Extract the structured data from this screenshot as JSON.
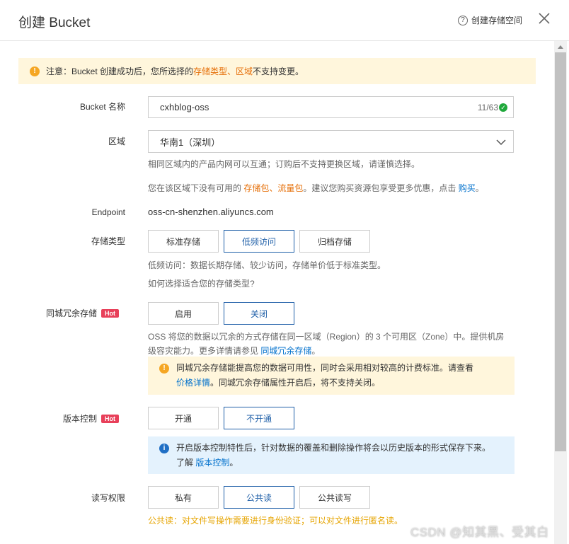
{
  "header": {
    "title": "创建 Bucket",
    "help_label": "创建存储空间",
    "help_icon": "help-circle-icon",
    "close_icon": "close-icon"
  },
  "notice": {
    "prefix": "注意：Bucket 创建成功后，您所选择的 ",
    "highlight": "存储类型、区域",
    "suffix": " 不支持变更。"
  },
  "bucket_name": {
    "label": "Bucket 名称",
    "value": "cxhblog-oss",
    "counter": "11/63"
  },
  "region": {
    "label": "区域",
    "value": "华南1（深圳）",
    "hint1": "相同区域内的产品内网可以互通；订购后不支持更换区域，请谨慎选择。",
    "hint2_prefix": "您在该区域下没有可用的 ",
    "hint2_highlight": "存储包、流量包",
    "hint2_mid": "。建议您购买资源包享受更多优惠，点击 ",
    "hint2_link": "购买",
    "hint2_suffix": "。"
  },
  "endpoint": {
    "label": "Endpoint",
    "value": "oss-cn-shenzhen.aliyuncs.com"
  },
  "storage_class": {
    "label": "存储类型",
    "options": [
      "标准存储",
      "低频访问",
      "归档存储"
    ],
    "selected": "低频访问",
    "hint": "低频访问：数据长期存储、较少访问，存储单价低于标准类型。",
    "link": "如何选择适合您的存储类型?"
  },
  "zone_redundancy": {
    "label": "同城冗余存储",
    "badge": "Hot",
    "options": [
      "启用",
      "关闭"
    ],
    "selected": "关闭",
    "hint_line1": "OSS 将您的数据以冗余的方式存储在同一区域（Region）的 3 个可用区（Zone）中。提供机房",
    "hint_line2_prefix": "级容灾能力。更多详情请参见 ",
    "hint_line2_link": "同城冗余存储",
    "hint_line2_suffix": "。",
    "tip_line1": "同城冗余存储能提高您的数据可用性，同时会采用相对较高的计费标准。请查看",
    "tip_link": "价格详情",
    "tip_suffix": "。同城冗余存储属性开启后，将不支持关闭。"
  },
  "versioning": {
    "label": "版本控制",
    "badge": "Hot",
    "options": [
      "开通",
      "不开通"
    ],
    "selected": "不开通",
    "tip_line1": "开启版本控制特性后，针对数据的覆盖和删除操作将会以历史版本的形式保存下来。",
    "tip_prefix": "了解 ",
    "tip_link": "版本控制",
    "tip_suffix": "。"
  },
  "acl": {
    "label": "读写权限",
    "options": [
      "私有",
      "公共读",
      "公共读写"
    ],
    "selected": "公共读",
    "warning": "公共读：对文件写操作需要进行身份验证；可以对文件进行匿名读。"
  },
  "watermark": "CSDN @知其黑、受其白",
  "colors": {
    "accent": "#1f5fa8",
    "link": "#0070cc",
    "orange": "#e6700a",
    "hot": "#e8405a",
    "notice_bg": "#fff6dc",
    "info_bg": "#e4f2fd"
  }
}
